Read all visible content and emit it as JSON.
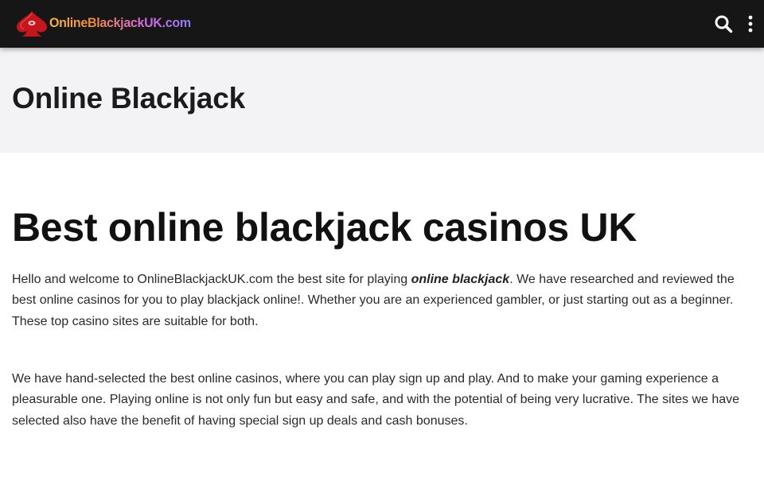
{
  "header": {
    "logo_text": "OnlineBlackjackUK.com",
    "search_icon": "search-icon",
    "menu_icon": "vertical-dots-icon",
    "background": "#161616"
  },
  "title_band": {
    "title": "Online Blackjack",
    "background": "#f3f3f5"
  },
  "main": {
    "heading": "Best online blackjack casinos UK",
    "paragraph1": {
      "before": "Hello and welcome to OnlineBlackjackUK.com the best site for playing ",
      "emphasis": "online blackjack",
      "after": ". We have researched and reviewed the best online casinos for you to play blackjack online!.  Whether you are an experienced gambler, or just starting out as a beginner. These top casino sites are suitable for both."
    },
    "paragraph2": "We have hand-selected the best online casinos, where you can play sign up and play. And to make your gaming experience a pleasurable one. Playing online is not only fun but easy and safe, and with the potential of being very lucrative. The sites we have selected also have the benefit of having special sign up deals and cash bonuses."
  }
}
